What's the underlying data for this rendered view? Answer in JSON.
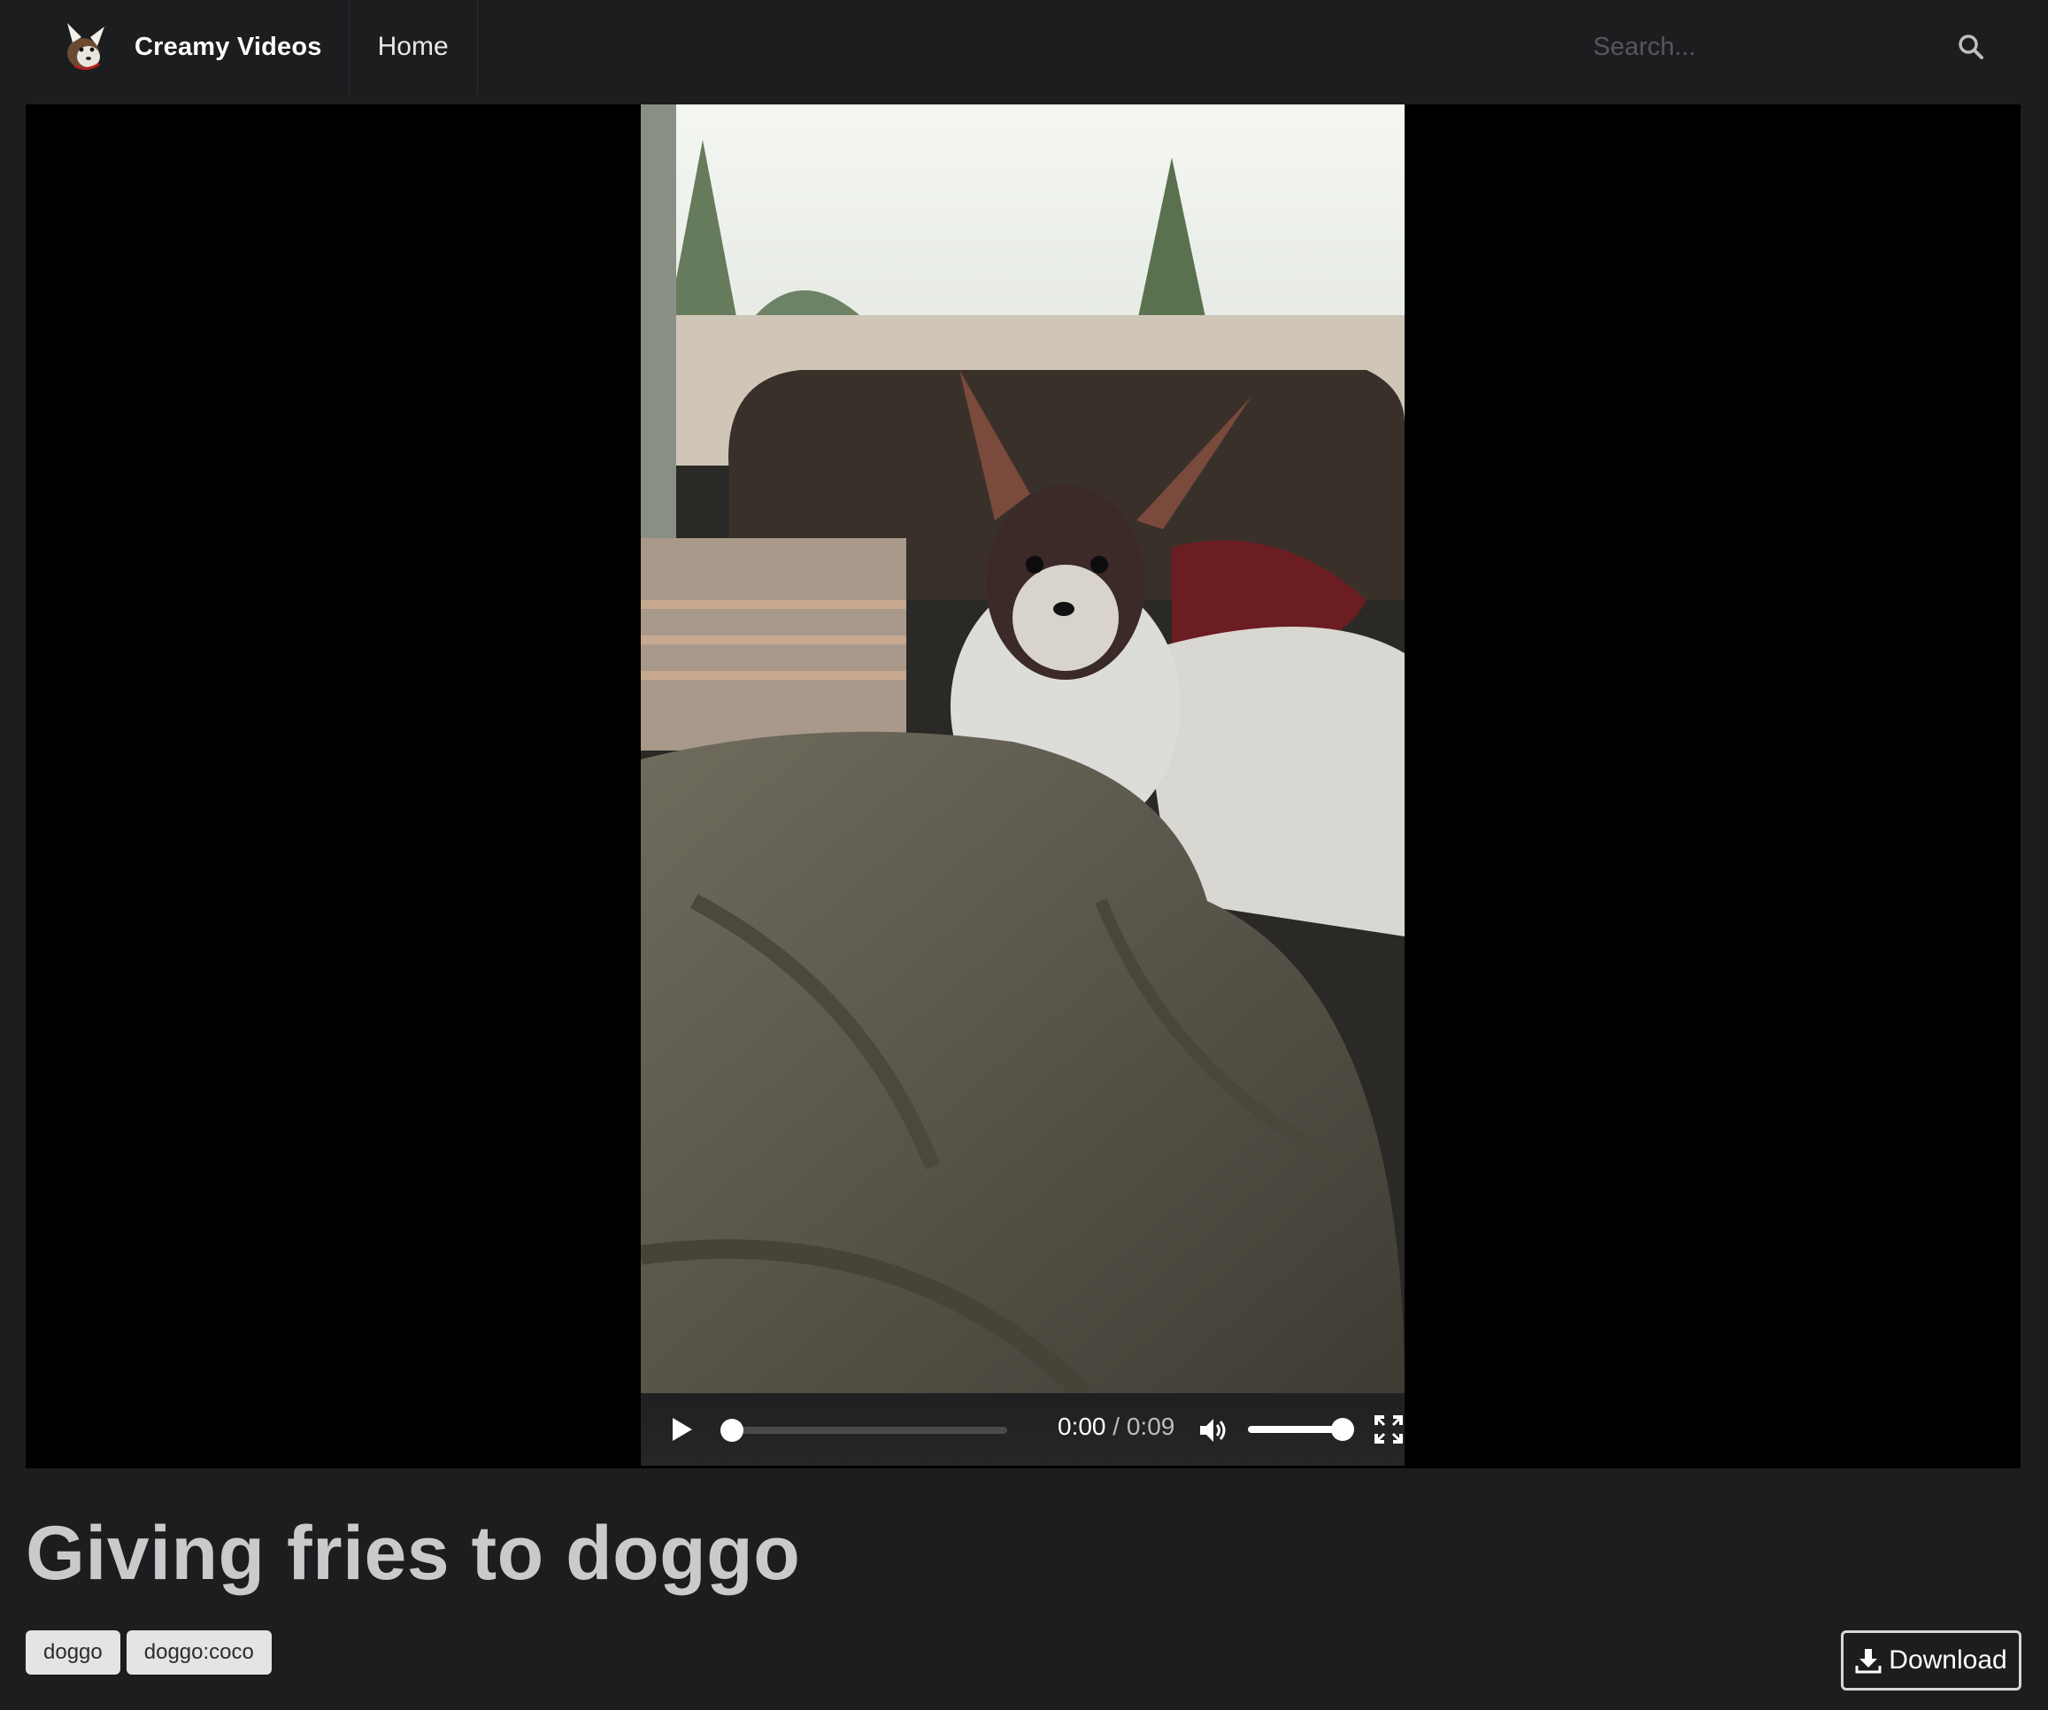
{
  "navbar": {
    "brand_name": "Creamy Videos",
    "links": [
      {
        "label": "Home"
      }
    ],
    "search": {
      "placeholder": "Search...",
      "icon": "search-icon"
    }
  },
  "player": {
    "current_time": "0:00",
    "separator": " / ",
    "duration": "0:09",
    "progress": 0.0,
    "volume": 1.0,
    "icons": {
      "play": "play-icon",
      "volume": "volume-icon",
      "fullscreen": "fullscreen-icon"
    }
  },
  "video": {
    "title": "Giving fries to doggo",
    "tags": [
      "doggo",
      "doggo:coco"
    ]
  },
  "actions": {
    "download_label": "Download",
    "download_icon": "download-icon"
  }
}
